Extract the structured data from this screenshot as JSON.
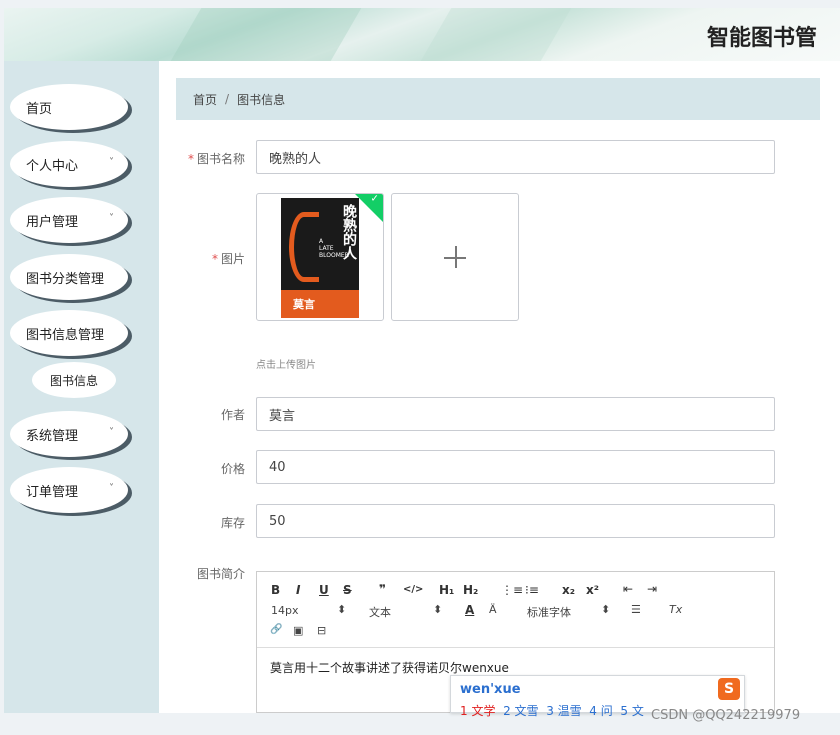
{
  "header": {
    "title": "智能图书管"
  },
  "sidebar": {
    "items": [
      {
        "label": "首页",
        "has_chevron": false
      },
      {
        "label": "个人中心",
        "has_chevron": true
      },
      {
        "label": "用户管理",
        "has_chevron": true
      },
      {
        "label": "图书分类管理",
        "has_chevron": false
      },
      {
        "label": "图书信息管理",
        "has_chevron": false
      },
      {
        "label": "系统管理",
        "has_chevron": true
      },
      {
        "label": "订单管理",
        "has_chevron": true
      }
    ],
    "sub_item": "图书信息",
    "chevron_glyph": "˅"
  },
  "breadcrumb": {
    "home": "首页",
    "separator": "/",
    "current": "图书信息"
  },
  "form": {
    "book_name": {
      "label": "图书名称",
      "value": "晚熟的人"
    },
    "image": {
      "label": "图片",
      "hint": "点击上传图片"
    },
    "author": {
      "label": "作者",
      "value": "莫言"
    },
    "price": {
      "label": "价格",
      "value": "40"
    },
    "stock": {
      "label": "库存",
      "value": "50"
    },
    "intro": {
      "label": "图书简介"
    }
  },
  "cover": {
    "title": "晚熟的人",
    "en_line1": "A",
    "en_line2": "LATE",
    "en_line3": "BLOOMER",
    "author": "莫言"
  },
  "editor": {
    "toolbar": {
      "bold": "B",
      "italic": "I",
      "underline": "U",
      "strike": "S",
      "quote": "❞",
      "code": "</>",
      "h1": "H₁",
      "h2": "H₂",
      "ordered": "⋮≡",
      "bullet": "⁝≡",
      "sub": "x₂",
      "sup": "x²",
      "outdent": "⇤",
      "indent": "⇥",
      "size": "14px",
      "format": "文本",
      "font": "标准字体",
      "color": "A",
      "bg": "Ä",
      "align": "☰",
      "clear": "Tx",
      "link": "🔗",
      "image": "▣",
      "video": "⊟",
      "dropdown": "⬍"
    },
    "content": "莫言用十二个故事讲述了获得诺贝尔wenxue",
    "ime": {
      "pinyin": "wen'xue",
      "candidates": [
        "1 文学",
        "2 文雪",
        "3 温雪",
        "4 问",
        "5 文"
      ],
      "logo": "S"
    }
  },
  "watermark": "CSDN @QQ242219979",
  "colors": {
    "sidebar": "#d6e6ea",
    "accent_required": "#e05050",
    "upload_success": "#13ce66"
  }
}
